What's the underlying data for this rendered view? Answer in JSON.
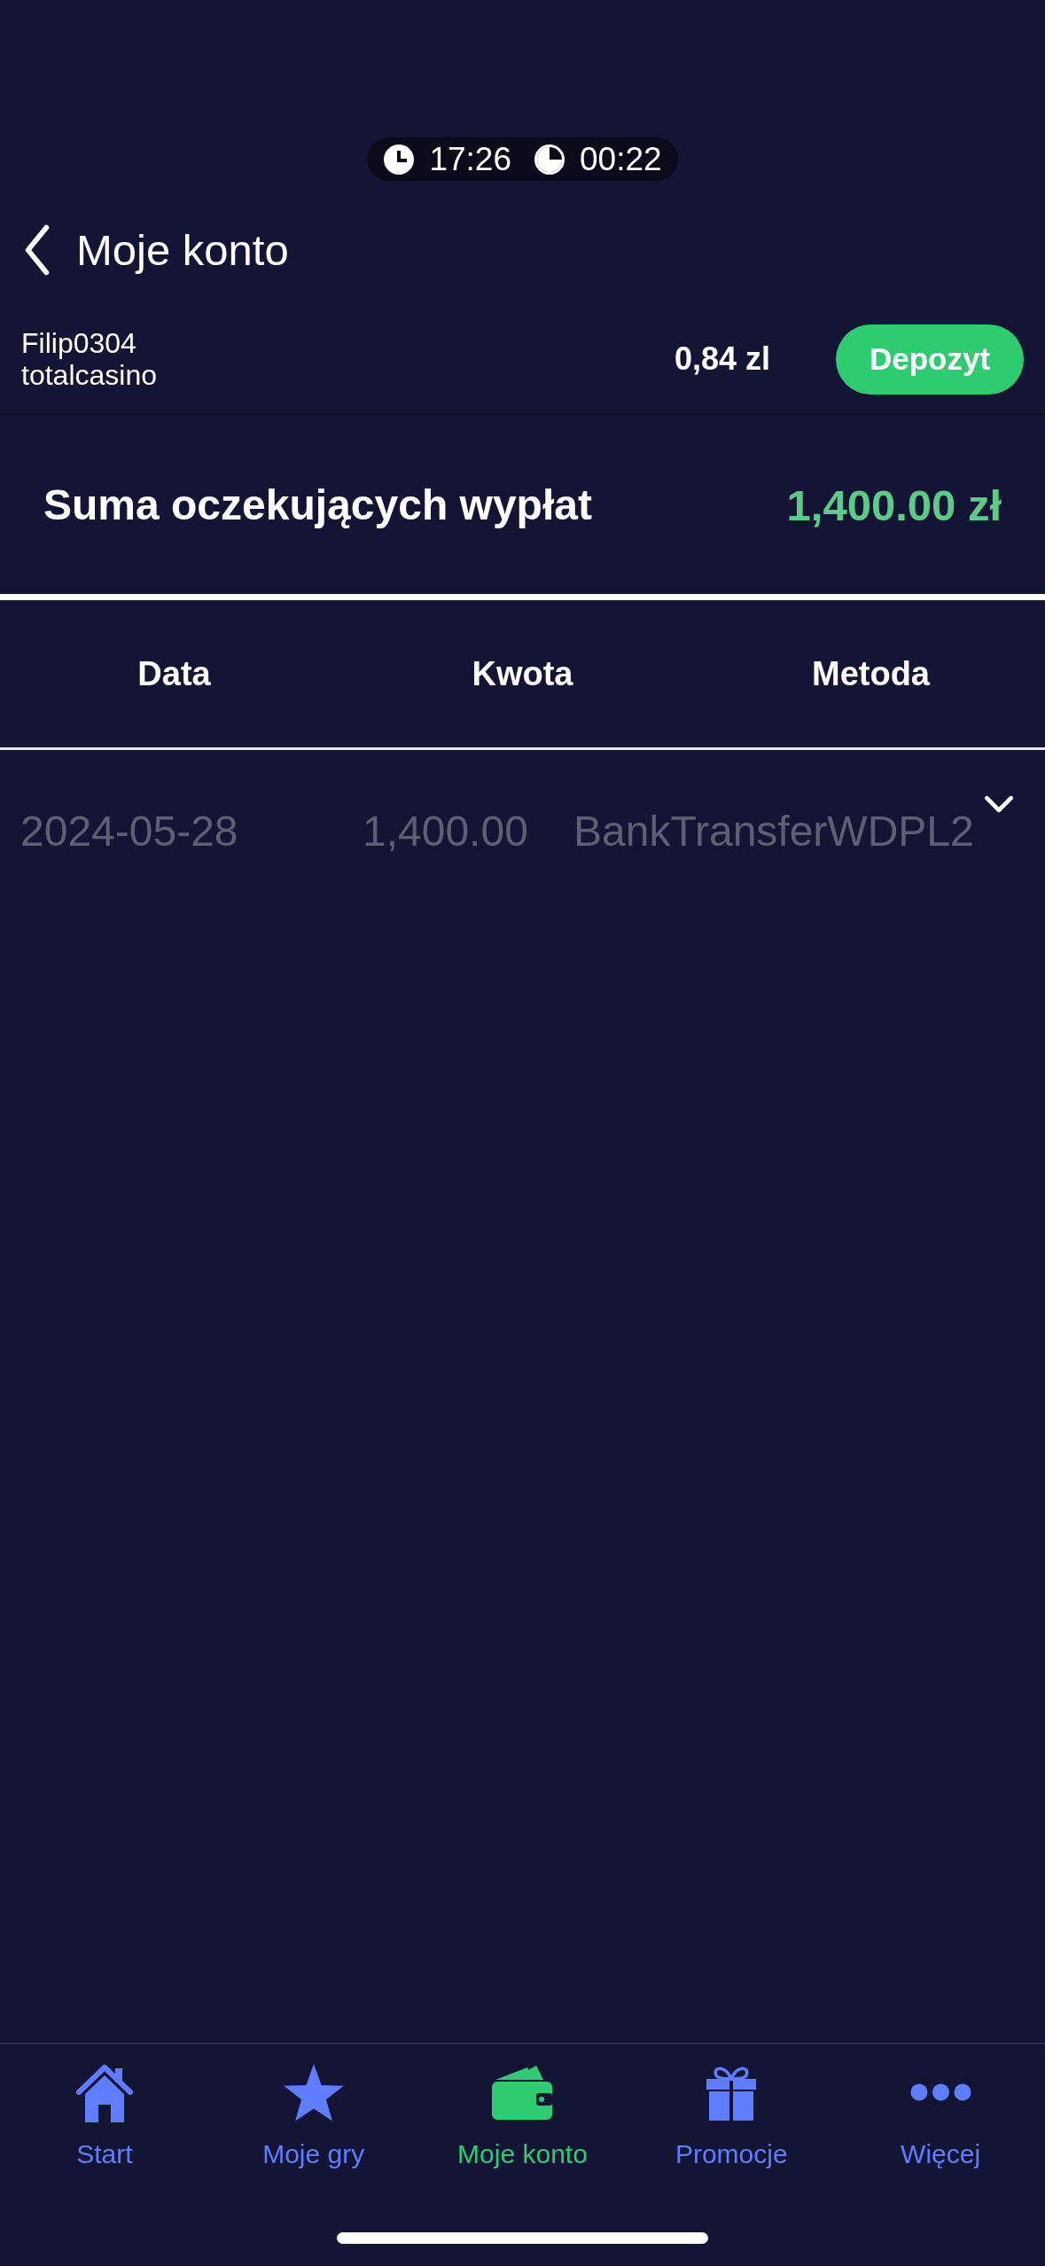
{
  "session_timer": {
    "clock_time": "17:26",
    "session_time": "00:22"
  },
  "header": {
    "title": "Moje konto"
  },
  "account": {
    "username": "Filip0304",
    "site": "totalcasino",
    "balance": "0,84 zl",
    "deposit_button": "Depozyt"
  },
  "pending_withdrawals": {
    "label": "Suma oczekujących wypłat",
    "total": "1,400.00 zł"
  },
  "table": {
    "columns": [
      "Data",
      "Kwota",
      "Metoda"
    ],
    "rows": [
      {
        "cells": [
          "2024-05-28",
          "1,400.00",
          "BankTransferWDPL2"
        ],
        "expanded": false
      }
    ]
  },
  "tab_bar": {
    "items": [
      {
        "label": "Start",
        "selected": false
      },
      {
        "label": "Moje gry",
        "selected": false
      },
      {
        "label": "Moje konto",
        "selected": true
      },
      {
        "label": "Promocje",
        "selected": false
      },
      {
        "label": "Więcej",
        "selected": false
      }
    ]
  }
}
